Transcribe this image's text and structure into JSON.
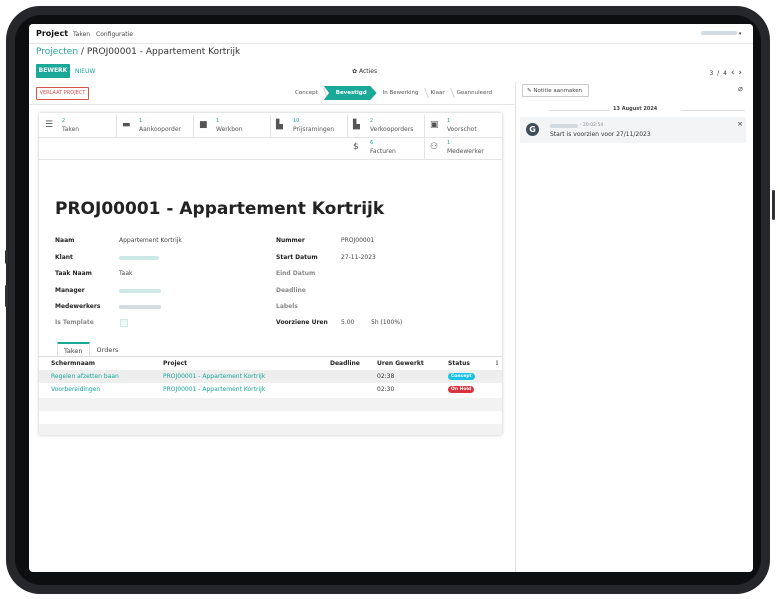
{
  "topbar": {
    "app_title": "Project",
    "menu": [
      "Taken",
      "Configuratie"
    ]
  },
  "breadcrumb": {
    "parent": "Projecten",
    "separator": "/",
    "current": "PROJ00001 - Appartement Kortrijk"
  },
  "actions": {
    "edit": "BEWERK",
    "new": "NIEUW",
    "more": "Acties",
    "pager": "3 / 4"
  },
  "header": {
    "leave_button": "VERLAAT PROJECT"
  },
  "stages": [
    "Concept",
    "Bevestigd",
    "In Bewerking",
    "Klaar",
    "Geannuleerd"
  ],
  "active_stage": "Bevestigd",
  "smart_buttons": [
    {
      "count": "2",
      "label": "Taken",
      "icon": "list-icon"
    },
    {
      "count": "1",
      "label": "Aankooporder",
      "icon": "credit-card-icon"
    },
    {
      "count": "1",
      "label": "Werkbon",
      "icon": "briefcase-icon"
    },
    {
      "count": "10",
      "label": "Prijsramingen",
      "icon": "file-icon"
    },
    {
      "count": "2",
      "label": "Verkooporders",
      "icon": "file-icon"
    },
    {
      "count": "1",
      "label": "Voorschot",
      "icon": "money-icon"
    },
    {
      "count": "6",
      "label": "Facturen",
      "icon": "dollar-icon"
    },
    {
      "count": "1",
      "label": "Medewerker",
      "icon": "users-icon"
    }
  ],
  "record": {
    "title": "PROJ00001 - Appartement Kortrijk",
    "left_fields": [
      {
        "label": "Naam",
        "value": "Appartement Kortrijk"
      },
      {
        "label": "Klant",
        "value": ""
      },
      {
        "label": "Taak Naam",
        "value": "Taak"
      },
      {
        "label": "Manager",
        "value": ""
      },
      {
        "label": "Medewerkers",
        "value": ""
      },
      {
        "label": "Is Template",
        "value": ""
      }
    ],
    "right_fields": [
      {
        "label": "Nummer",
        "value": "PROJ00001"
      },
      {
        "label": "Start Datum",
        "value": "27-11-2023"
      },
      {
        "label": "Eind Datum",
        "value": ""
      },
      {
        "label": "Deadline",
        "value": ""
      },
      {
        "label": "Labels",
        "value": ""
      },
      {
        "label": "Voorziene Uren",
        "value": "5.00",
        "extra": "5h (100%)"
      }
    ]
  },
  "tabs": [
    "Taken",
    "Orders"
  ],
  "table": {
    "columns": [
      "Schermnaam",
      "Project",
      "Deadline",
      "Uren Gewerkt",
      "Status"
    ],
    "rows": [
      {
        "name": "Regelen afzetten baan",
        "project": "PROJ00001 - Appartement Kortrijk",
        "deadline": "",
        "hours": "02:38",
        "status": "Concept",
        "status_color": "#17c1e8"
      },
      {
        "name": "Voorbereidingen",
        "project": "PROJ00001 - Appartement Kortrijk",
        "deadline": "",
        "hours": "02:30",
        "status": "On Hold",
        "status_color": "#d9343c"
      }
    ]
  },
  "chatter": {
    "note_button": "Notitie aanmaken",
    "date": "13 August 2024",
    "messages": [
      {
        "avatar": "G",
        "time": "- 20:02:54",
        "text": "Start is voorzien voor 27/11/2023"
      }
    ]
  },
  "colors": {
    "accent": "#1aa899",
    "danger": "#d9534f"
  }
}
